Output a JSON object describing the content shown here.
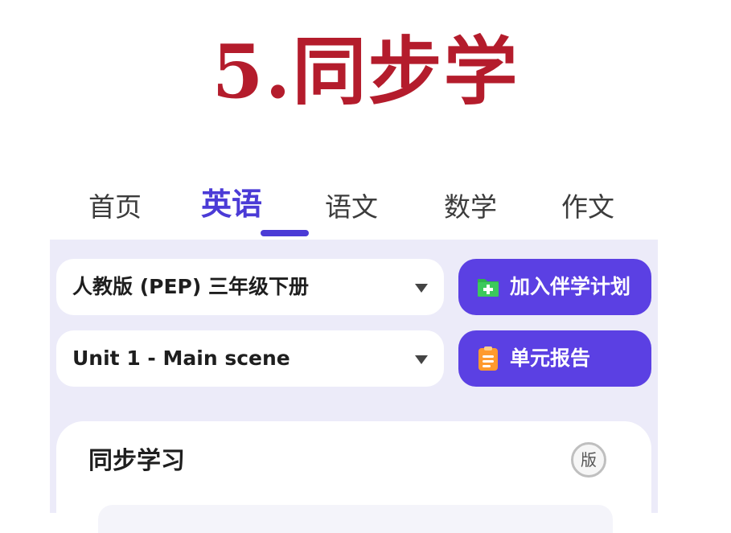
{
  "headline": "5.同步学",
  "tabs": [
    {
      "label": "首页",
      "active": false
    },
    {
      "label": "英语",
      "active": true
    },
    {
      "label": "语文",
      "active": false
    },
    {
      "label": "数学",
      "active": false
    },
    {
      "label": "作文",
      "active": false
    }
  ],
  "selectors": {
    "textbook": "人教版 (PEP) 三年级下册",
    "unit": "Unit 1 - Main scene"
  },
  "buttons": {
    "join_plan": {
      "label": "加入伴学计划",
      "icon": "folder-plus-icon"
    },
    "unit_report": {
      "label": "单元报告",
      "icon": "clipboard-icon"
    }
  },
  "card": {
    "title": "同步学习",
    "badge": "版"
  },
  "colors": {
    "headline": "#b41c2c",
    "accent": "#4b3bd6",
    "button": "#5b40e3",
    "panel_bg": "#ecebf9"
  }
}
